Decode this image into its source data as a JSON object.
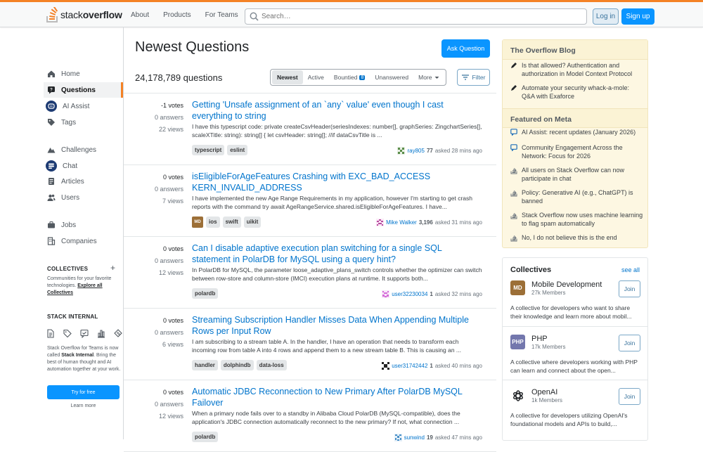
{
  "header": {
    "logo_text_light": "stack",
    "logo_text_bold": "overflow",
    "nav": [
      "About",
      "Products",
      "For Teams"
    ],
    "search_placeholder": "Search…",
    "login_label": "Log in",
    "signup_label": "Sign up"
  },
  "sidebar": {
    "items": [
      {
        "label": "Home",
        "icon": "home-icon"
      },
      {
        "label": "Questions",
        "icon": "questions-icon"
      },
      {
        "label": "AI Assist",
        "icon": "ai-assist-icon"
      },
      {
        "label": "Tags",
        "icon": "tag-icon"
      },
      {
        "label": "Challenges",
        "icon": "challenges-icon"
      },
      {
        "label": "Chat",
        "icon": "chat-icon"
      },
      {
        "label": "Articles",
        "icon": "articles-icon"
      },
      {
        "label": "Users",
        "icon": "users-icon"
      },
      {
        "label": "Jobs",
        "icon": "jobs-icon"
      },
      {
        "label": "Companies",
        "icon": "companies-icon"
      }
    ],
    "collectives_title": "COLLECTIVES",
    "collectives_text": "Communities for your favorite technologies.",
    "collectives_link": "Explore all Collectives",
    "stack_internal_title": "STACK INTERNAL",
    "stack_internal_text_1": "Stack Overflow for Teams is now called",
    "stack_internal_bold": "Stack Internal",
    "stack_internal_text_2": ". Bring the best of human thought and AI automation together at your work.",
    "try_label": "Try for free",
    "learn_label": "Learn more"
  },
  "main": {
    "title": "Newest Questions",
    "ask_label": "Ask Question",
    "count": "24,178,789 questions",
    "filters": [
      {
        "label": "Newest"
      },
      {
        "label": "Active"
      },
      {
        "label": "Bountied",
        "badge": "8"
      },
      {
        "label": "Unanswered"
      },
      {
        "label": "More"
      }
    ],
    "filter_label": "Filter",
    "questions": [
      {
        "votes": "-1 votes",
        "answers": "0 answers",
        "views": "22 views",
        "title": "Getting 'Unsafe assignment of an `any` value' even though I cast everything to string",
        "excerpt": "I have this typescript code: private createCsvHeader(seriesIndexes: number[], graphSeries: ZingchartSeries[], scaleXTitle: string): string[] { let csvHeader: string[]; //if dataCsvTitle is ...",
        "tags": [
          "typescript",
          "eslint"
        ],
        "user": "ray805",
        "rep": "77",
        "time": "asked 28 mins ago",
        "avatar_color": "#5a8d4a"
      },
      {
        "votes": "0 votes",
        "answers": "0 answers",
        "views": "7 views",
        "title": "isEligibleForAgeFeatures Crashing with EXC_BAD_ACCESS KERN_INVALID_ADDRESS",
        "excerpt": "I have implemented the new Age Range Requirements in my application, however I'm starting to get crash reports with the command try await AgeRangeService.shared.isEligibleForAgeFeatures. I have...",
        "tags": [
          "ios",
          "swift",
          "uikit"
        ],
        "collective_badge": "MD",
        "user": "Mike Walker",
        "rep": "3,196",
        "time": "asked 31 mins ago",
        "avatar_color": "#b84ca0"
      },
      {
        "votes": "0 votes",
        "answers": "0 answers",
        "views": "12 views",
        "title": "Can I disable adaptive execution plan switching for a single SQL statement in PolarDB for MySQL using a query hint?",
        "excerpt": "In PolarDB for MySQL, the parameter loose_adaptive_plans_switch controls whether the optimizer can switch between row-store and column-store (IMCI) execution plans at runtime. It supports both...",
        "tags": [
          "polardb"
        ],
        "user": "user32230034",
        "rep": "1",
        "time": "asked 32 mins ago",
        "avatar_color": "#d46bd8"
      },
      {
        "votes": "0 votes",
        "answers": "0 answers",
        "views": "6 views",
        "title": "Streaming Subscription Handler Misses Data When Appending Multiple Rows per Input Row",
        "excerpt": "I am subscribing to a stream table A. In the handler, I have an operation that needs to transform each incoming row from table A into 4 rows and append them to a new stream table B. This is causing an ...",
        "tags": [
          "handler",
          "dolphindb",
          "data-loss"
        ],
        "user": "user31742442",
        "rep": "1",
        "time": "asked 40 mins ago",
        "avatar_color": "#222222"
      },
      {
        "votes": "0 votes",
        "answers": "0 answers",
        "views": "12 views",
        "title": "Automatic JDBC Reconnection to New Primary After PolarDB MySQL Failover",
        "excerpt": "When a primary node fails over to a standby in Alibaba Cloud PolarDB (MySQL-compatible), does the application's JDBC connection automatically reconnect to the new primary? If not, what connection ...",
        "tags": [
          "polardb"
        ],
        "user": "sunwind",
        "rep": "19",
        "time": "asked 47 mins ago",
        "avatar_color": "#4a90c7"
      }
    ]
  },
  "blog": {
    "title": "The Overflow Blog",
    "items": [
      "Is that allowed? Authentication and authorization in Model Context Protocol",
      "Automate your security whack-a-mole: Q&A with Exaforce"
    ],
    "meta_title": "Featured on Meta",
    "meta_items": [
      {
        "text": "AI Assist: recent updates (January 2026)",
        "icon": "chat-bubble-icon"
      },
      {
        "text": "Community Engagement Across the Network: Focus for 2026",
        "icon": "chat-bubble-icon"
      },
      {
        "text": "All users on Stack Overflow can now participate in chat",
        "icon": "stack-logo-icon"
      },
      {
        "text": "Policy: Generative AI (e.g., ChatGPT) is banned",
        "icon": "stack-logo-icon"
      },
      {
        "text": "Stack Overflow now uses machine learning to flag spam automatically",
        "icon": "stack-logo-icon"
      },
      {
        "text": "No, I do not believe this is the end",
        "icon": "stack-logo-icon"
      }
    ]
  },
  "collectives": {
    "title": "Collectives",
    "see_all": "see all",
    "items": [
      {
        "name": "Mobile Development",
        "members": "27k Members",
        "desc": "A collective for developers who want to share their knowledge and learn more about mobil...",
        "logo": "MD",
        "color": "#9c6f37",
        "join": "Join"
      },
      {
        "name": "PHP",
        "members": "17k Members",
        "desc": "A collective where developers working with PHP can learn and connect about the open...",
        "logo": "PHP",
        "color": "#7377ad",
        "join": "Join"
      },
      {
        "name": "OpenAI",
        "members": "1k Members",
        "desc": "A collective for developers utilizing OpenAI's foundational models and APIs to build,...",
        "logo": "openai-icon",
        "color": "#ffffff",
        "join": "Join"
      }
    ]
  }
}
